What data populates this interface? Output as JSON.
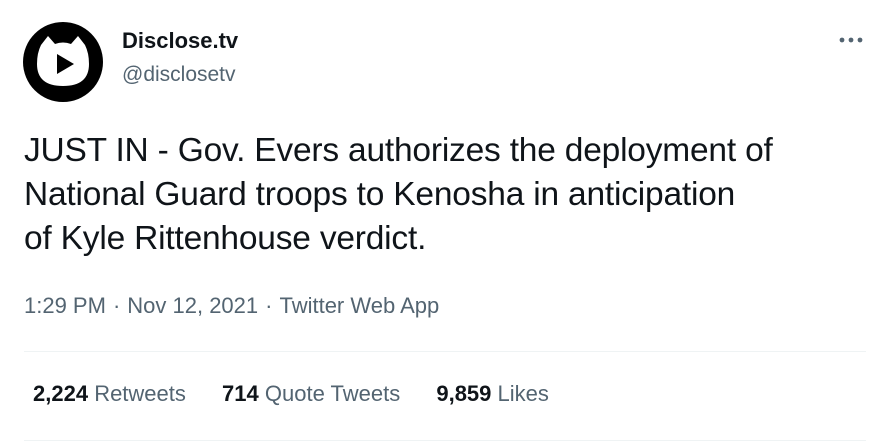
{
  "author": {
    "display_name": "Disclose.tv",
    "handle": "@disclosetv",
    "avatar_icon": "play-cat-logo-icon"
  },
  "more_icon": "more-dots-icon",
  "tweet": {
    "lines": [
      "JUST IN - Gov. Evers authorizes the deployment of",
      "National Guard troops to Kenosha in anticipation",
      "of Kyle Rittenhouse verdict."
    ]
  },
  "meta": {
    "time": "1:29 PM",
    "separator": "·",
    "date": "Nov 12, 2021",
    "source": "Twitter Web App"
  },
  "stats": {
    "retweets": {
      "count": "2,224",
      "label": "Retweets"
    },
    "quotes": {
      "count": "714",
      "label": "Quote Tweets"
    },
    "likes": {
      "count": "9,859",
      "label": "Likes"
    }
  },
  "colors": {
    "text_primary": "#0f1419",
    "text_secondary": "#536471",
    "divider": "#eff3f4",
    "avatar_bg": "#000000"
  }
}
